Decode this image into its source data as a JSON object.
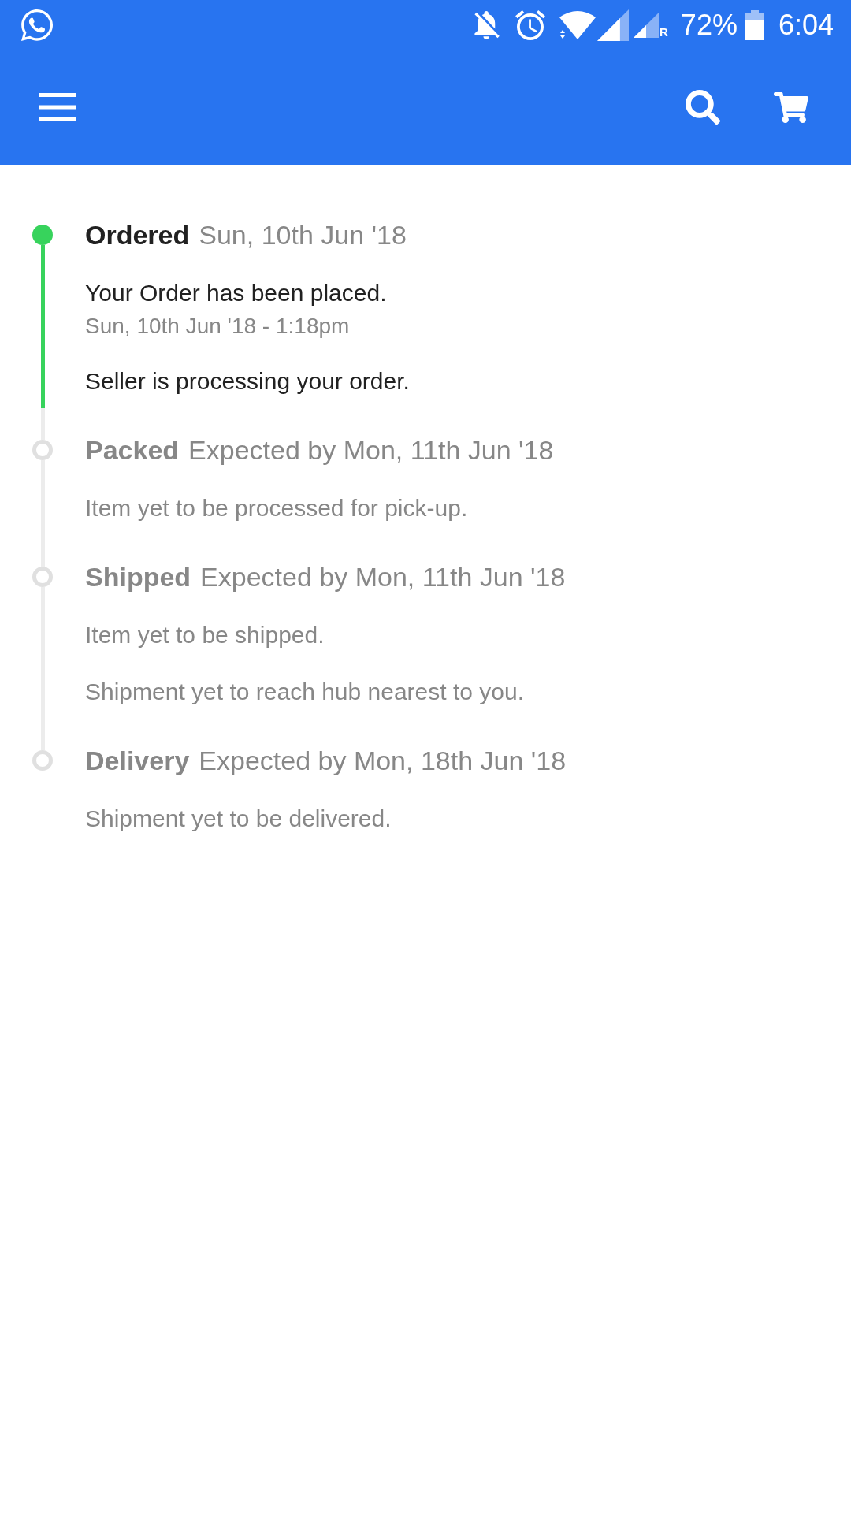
{
  "status_bar": {
    "roaming": "R",
    "battery": "72%",
    "time": "6:04"
  },
  "timeline": [
    {
      "title": "Ordered",
      "date": "Sun, 10th Jun '18",
      "completed": true,
      "events": [
        {
          "text": "Your Order has been placed.",
          "time": "Sun, 10th Jun '18 - 1:18pm"
        },
        {
          "text": "Seller is processing your order."
        }
      ]
    },
    {
      "title": "Packed",
      "date": "Expected by Mon, 11th Jun '18",
      "completed": false,
      "events": [
        {
          "text": "Item yet to be processed for pick-up."
        }
      ]
    },
    {
      "title": "Shipped",
      "date": "Expected by Mon, 11th Jun '18",
      "completed": false,
      "events": [
        {
          "text": "Item yet to be shipped."
        },
        {
          "text": "Shipment yet to reach hub nearest to you."
        }
      ]
    },
    {
      "title": "Delivery",
      "date": "Expected by Mon, 18th Jun '18",
      "completed": false,
      "events": [
        {
          "text": "Shipment yet to be delivered."
        }
      ]
    }
  ]
}
